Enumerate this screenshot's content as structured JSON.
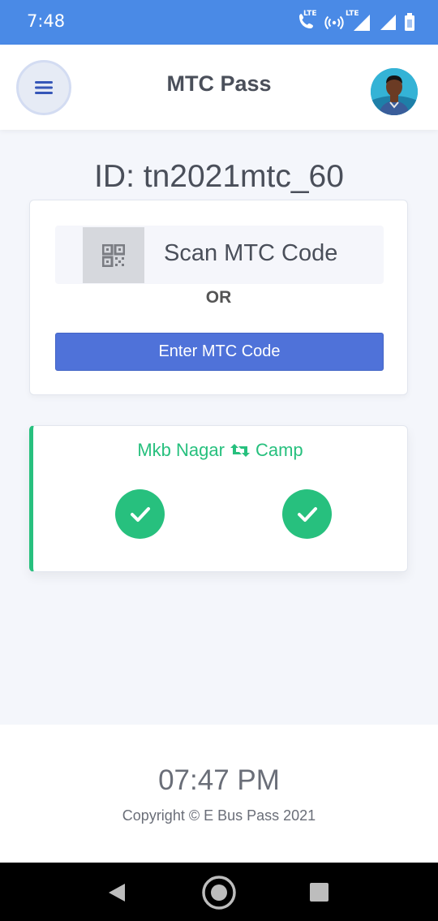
{
  "status_bar": {
    "time": "7:48",
    "lte1": "LTE",
    "lte2": "LTE"
  },
  "header": {
    "title": "MTC Pass",
    "menu_icon": "hamburger-icon",
    "avatar": "user-avatar"
  },
  "main": {
    "id_label": "ID: tn2021mtc_60",
    "scan_label": "Scan MTC Code",
    "or_label": "OR",
    "enter_button": "Enter MTC Code",
    "qr_icon": "qr-code-icon"
  },
  "route": {
    "from": "Mkb Nagar",
    "to": "Camp",
    "swap_icon": "retweet-icon",
    "checks": [
      "check-circle-icon",
      "check-circle-icon"
    ]
  },
  "footer": {
    "time": "07:47 PM",
    "copyright": "Copyright © E Bus Pass 2021"
  },
  "colors": {
    "status_bar": "#4a8ae6",
    "accent": "#4f72d9",
    "success": "#27c07e",
    "text": "#4a4f5a"
  }
}
